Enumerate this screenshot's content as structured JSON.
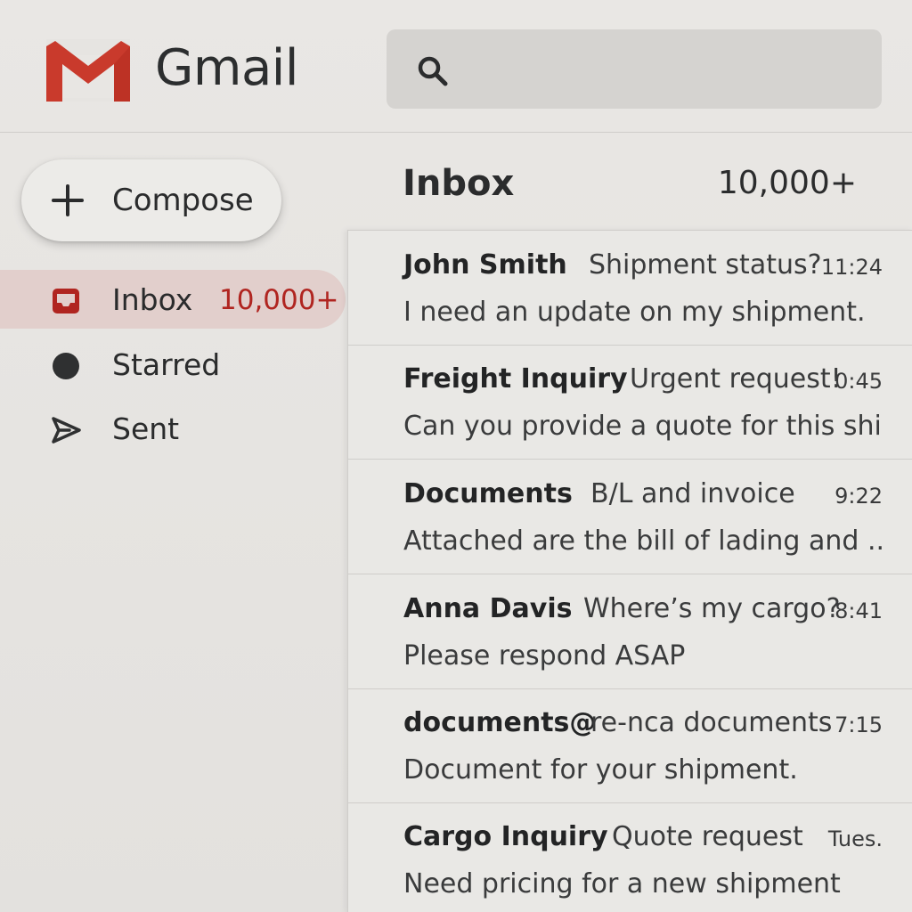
{
  "app": {
    "title": "Gmail",
    "brand_red": "#c93a2c"
  },
  "search": {
    "placeholder": ""
  },
  "sidebar": {
    "compose_label": "Compose",
    "items": [
      {
        "label": "Inbox",
        "count": "10,000+",
        "icon": "inbox-icon",
        "active": true
      },
      {
        "label": "Starred",
        "count": "",
        "icon": "star-dot-icon",
        "active": false
      },
      {
        "label": "Sent",
        "count": "",
        "icon": "send-icon",
        "active": false
      }
    ]
  },
  "main": {
    "title": "Inbox",
    "count": "10,000+"
  },
  "emails": [
    {
      "sender": "John Smith",
      "subject": "Shipment status?",
      "time": "11:24",
      "snippet": "I need an update on my shipment."
    },
    {
      "sender": "Freight Inquiry",
      "subject": "Urgent request!",
      "time": "0:45",
      "snippet": "Can you provide a quote for this shi..."
    },
    {
      "sender": "Documents",
      "subject": "B/L and invoice",
      "time": "9:22",
      "snippet": "Attached are the bill of lading and ..."
    },
    {
      "sender": "Anna Davis",
      "subject": "Where’s my cargo?",
      "time": "8:41",
      "snippet": "Please respond ASAP"
    },
    {
      "sender": "documents@",
      "subject": "re-nca documents",
      "time": "7:15",
      "snippet": "Document for your shipment."
    },
    {
      "sender": "Cargo Inquiry",
      "subject": "Quote request",
      "time": "Tues.",
      "snippet": "Need pricing for a new shipment"
    }
  ]
}
